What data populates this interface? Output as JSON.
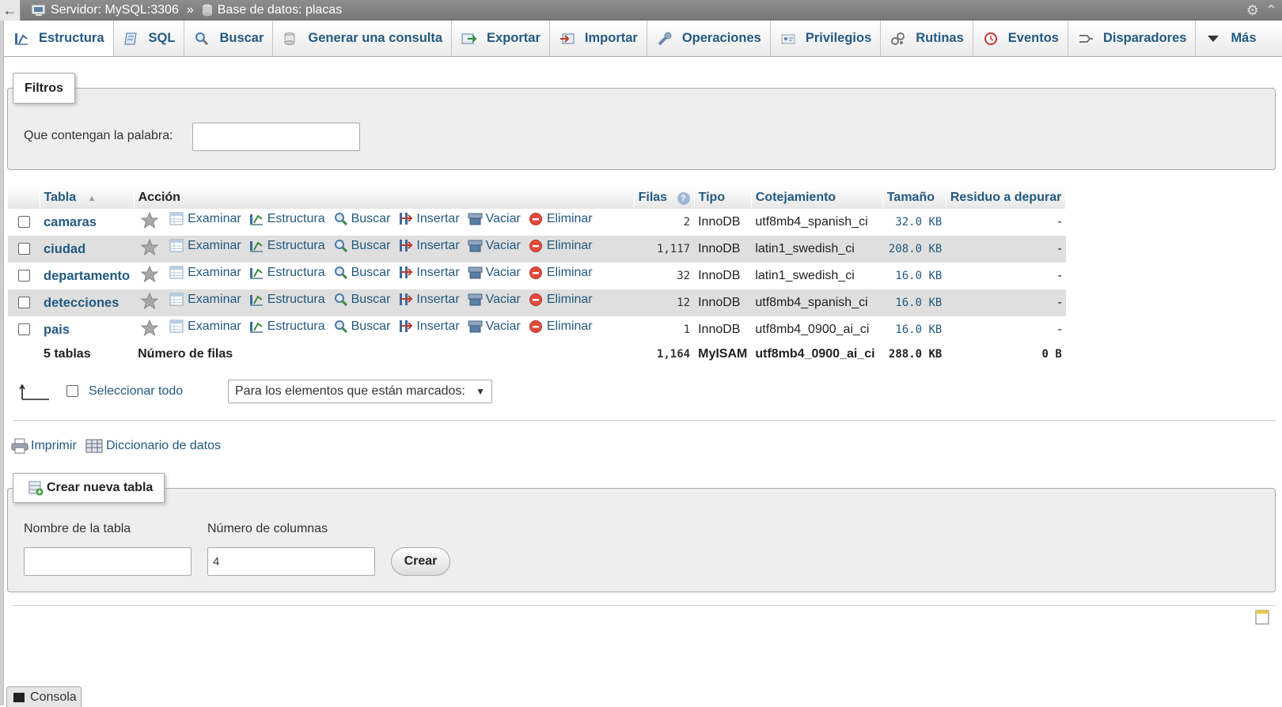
{
  "topbar": {
    "server": "Servidor: MySQL:3306",
    "separator": "»",
    "database": "Base de datos: placas"
  },
  "tabs": [
    {
      "label": "Estructura",
      "icon": "structure-icon"
    },
    {
      "label": "SQL",
      "icon": "sql-icon"
    },
    {
      "label": "Buscar",
      "icon": "search-icon"
    },
    {
      "label": "Generar una consulta",
      "icon": "query-icon"
    },
    {
      "label": "Exportar",
      "icon": "export-icon"
    },
    {
      "label": "Importar",
      "icon": "import-icon"
    },
    {
      "label": "Operaciones",
      "icon": "wrench-icon"
    },
    {
      "label": "Privilegios",
      "icon": "privileges-icon"
    },
    {
      "label": "Rutinas",
      "icon": "routines-icon"
    },
    {
      "label": "Eventos",
      "icon": "clock-icon"
    },
    {
      "label": "Disparadores",
      "icon": "triggers-icon"
    },
    {
      "label": "Más",
      "icon": "chevron-down-icon"
    }
  ],
  "filters": {
    "legend": "Filtros",
    "label": "Que contengan la palabra:",
    "value": ""
  },
  "table": {
    "headers": {
      "tabla": "Tabla",
      "accion": "Acción",
      "filas": "Filas",
      "tipo": "Tipo",
      "cotejamiento": "Cotejamiento",
      "tamano": "Tamaño",
      "residuo": "Residuo a depurar"
    },
    "actions": {
      "examinar": "Examinar",
      "estructura": "Estructura",
      "buscar": "Buscar",
      "insertar": "Insertar",
      "vaciar": "Vaciar",
      "eliminar": "Eliminar"
    },
    "rows": [
      {
        "name": "camaras",
        "rows": "2",
        "type": "InnoDB",
        "collation": "utf8mb4_spanish_ci",
        "size": "32.0 KB",
        "overhead": "-"
      },
      {
        "name": "ciudad",
        "rows": "1,117",
        "type": "InnoDB",
        "collation": "latin1_swedish_ci",
        "size": "208.0 KB",
        "overhead": "-"
      },
      {
        "name": "departamento",
        "rows": "32",
        "type": "InnoDB",
        "collation": "latin1_swedish_ci",
        "size": "16.0 KB",
        "overhead": "-"
      },
      {
        "name": "detecciones",
        "rows": "12",
        "type": "InnoDB",
        "collation": "utf8mb4_spanish_ci",
        "size": "16.0 KB",
        "overhead": "-"
      },
      {
        "name": "pais",
        "rows": "1",
        "type": "InnoDB",
        "collation": "utf8mb4_0900_ai_ci",
        "size": "16.0 KB",
        "overhead": "-"
      }
    ],
    "footer": {
      "count": "5 tablas",
      "label": "Número de filas",
      "rows": "1,164",
      "type": "MyISAM",
      "collation": "utf8mb4_0900_ai_ci",
      "size": "288.0 KB",
      "overhead": "0 B"
    }
  },
  "bulk": {
    "select_all": "Seleccionar todo",
    "with_selected": "Para los elementos que están marcados:"
  },
  "links": {
    "print": "Imprimir",
    "dictionary": "Diccionario de datos"
  },
  "create": {
    "legend": "Crear nueva tabla",
    "name_label": "Nombre de la tabla",
    "name_value": "",
    "cols_label": "Número de columnas",
    "cols_value": "4",
    "button": "Crear"
  },
  "console": {
    "label": "Consola"
  }
}
